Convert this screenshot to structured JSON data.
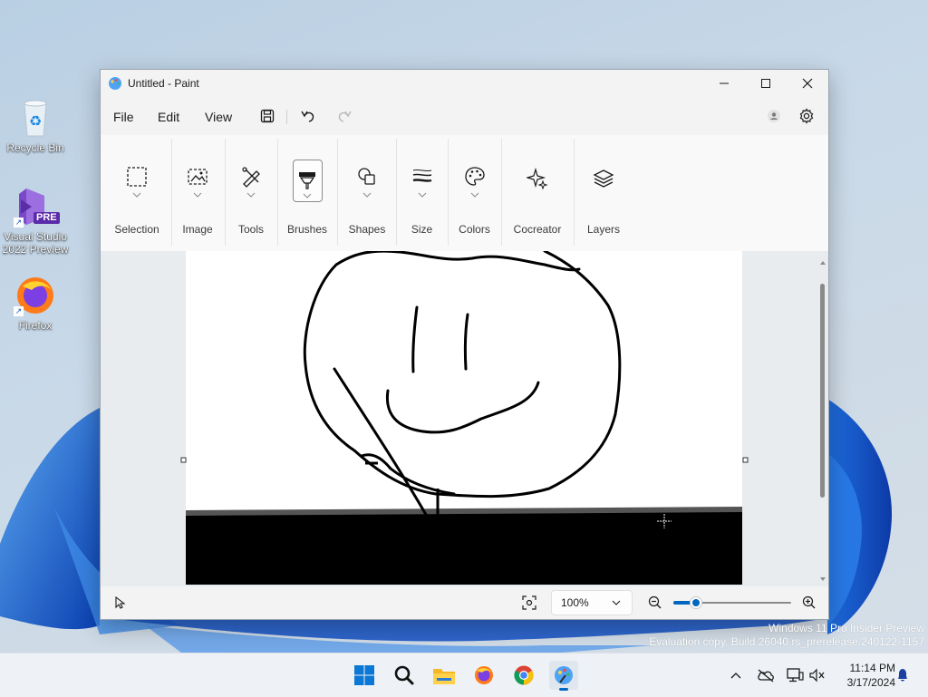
{
  "desktop": {
    "icons": [
      {
        "label": "Recycle Bin"
      },
      {
        "label_line1": "Visual Studio",
        "label_line2": "2022 Preview",
        "badge": "PRE"
      },
      {
        "label": "Firefox"
      }
    ],
    "watermark_line1": "Windows 11 Pro Insider Preview",
    "watermark_line2": "Evaluation copy. Build 26040.rs_prerelease.240122-1157"
  },
  "paint": {
    "title": "Untitled - Paint",
    "menu": {
      "file": "File",
      "edit": "Edit",
      "view": "View"
    },
    "ribbon": {
      "selection": "Selection",
      "image": "Image",
      "tools": "Tools",
      "brushes": "Brushes",
      "shapes": "Shapes",
      "size": "Size",
      "colors": "Colors",
      "cocreator": "Cocreator",
      "layers": "Layers"
    },
    "status": {
      "zoom": "100%",
      "zoom_slider_fraction": 0.16
    },
    "accent": "#0067c0"
  },
  "taskbar": {
    "time": "11:14 PM",
    "date": "3/17/2024",
    "apps": [
      "start-icon",
      "search-icon",
      "file-explorer-icon",
      "firefox-icon",
      "chrome-icon",
      "paint-icon"
    ]
  }
}
